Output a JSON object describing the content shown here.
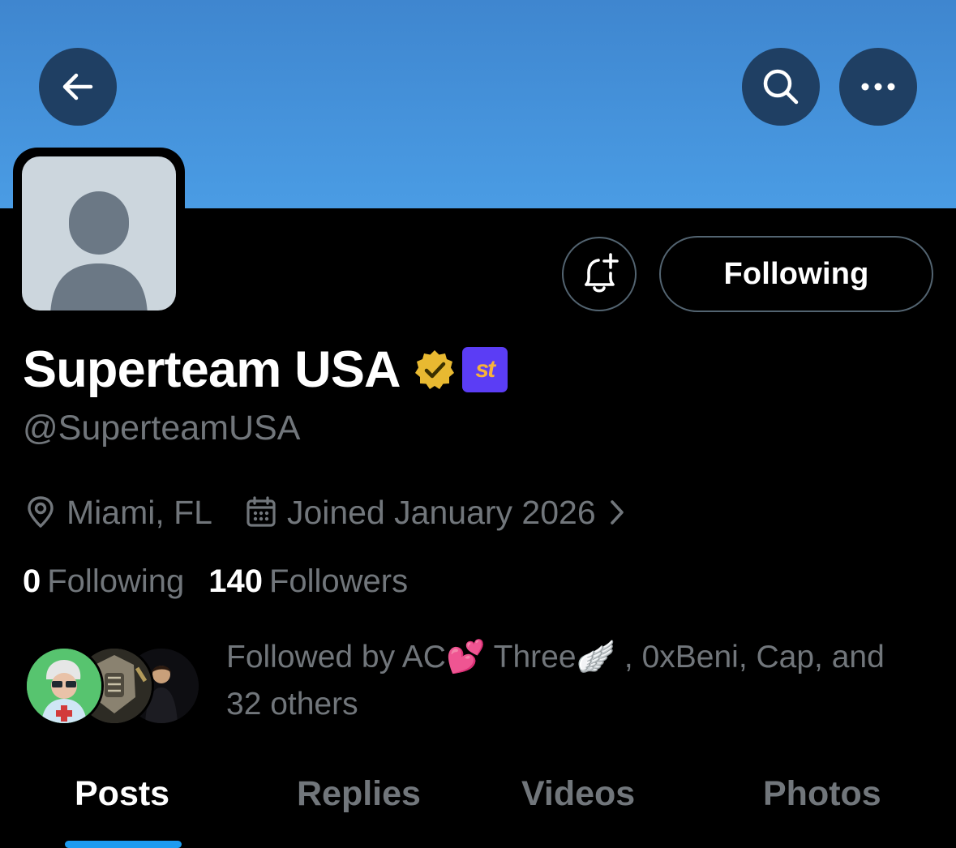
{
  "header": {
    "back_icon": "arrow-left-icon",
    "search_icon": "search-icon",
    "more_icon": "more-horizontal-icon",
    "banner_color": "#4a9ce4"
  },
  "profile": {
    "display_name": "Superteam USA",
    "handle": "@SuperteamUSA",
    "verified_badge_color": "#e8b931",
    "affiliate_badge": {
      "text": "st",
      "background": "#5b3df5",
      "color": "#f7b23b"
    },
    "location": "Miami, FL",
    "joined": "Joined January 2026",
    "following_count": "0",
    "following_label": "Following",
    "followers_count": "140",
    "followers_label": "Followers"
  },
  "actions": {
    "notify_icon": "bell-plus-icon",
    "follow_label": "Following"
  },
  "followed_by": {
    "line1": "Followed by AC💕 Three🪽 , 0xBeni, Cap, and",
    "line2": "32 others"
  },
  "tabs": [
    {
      "label": "Posts",
      "active": true
    },
    {
      "label": "Replies",
      "active": false
    },
    {
      "label": "Videos",
      "active": false
    },
    {
      "label": "Photos",
      "active": false
    }
  ],
  "colors": {
    "accent": "#1d9bf0",
    "secondary_text": "#71767b",
    "border": "#536471"
  }
}
